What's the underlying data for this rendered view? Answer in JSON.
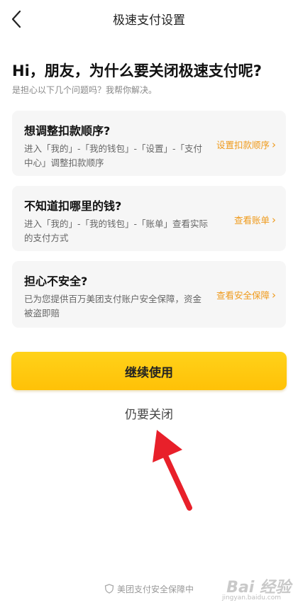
{
  "nav": {
    "title": "极速支付设置",
    "back_icon": "back-arrow-icon"
  },
  "headline": "Hi，朋友，为什么要关闭极速支付呢?",
  "subline": "是担心以下几个问题吗？我帮你解决。",
  "cards": [
    {
      "title": "想调整扣款顺序?",
      "desc": "进入「我的」-「我的钱包」-「设置」-「支付中心」调整扣款顺序",
      "link": "设置扣款顺序"
    },
    {
      "title": "不知道扣哪里的钱?",
      "desc": "进入「我的」-「我的钱包」-「账单」查看实际的支付方式",
      "link": "查看账单"
    },
    {
      "title": "担心不安全?",
      "desc": "已为您提供百万美团支付账户安全保障，资金被盗即赔",
      "link": "查看安全保障"
    }
  ],
  "actions": {
    "continue_label": "继续使用",
    "close_label": "仍要关闭"
  },
  "footer": {
    "text": "美团支付安全保障中",
    "icon": "shield-icon"
  },
  "watermark": {
    "text": "Bai 经验",
    "url": "jingyan.baidu.com"
  },
  "colors": {
    "accent": "#ef9a1b",
    "button": "#ffc107",
    "card_bg": "#f6f6f6",
    "arrow": "#e8202a"
  }
}
